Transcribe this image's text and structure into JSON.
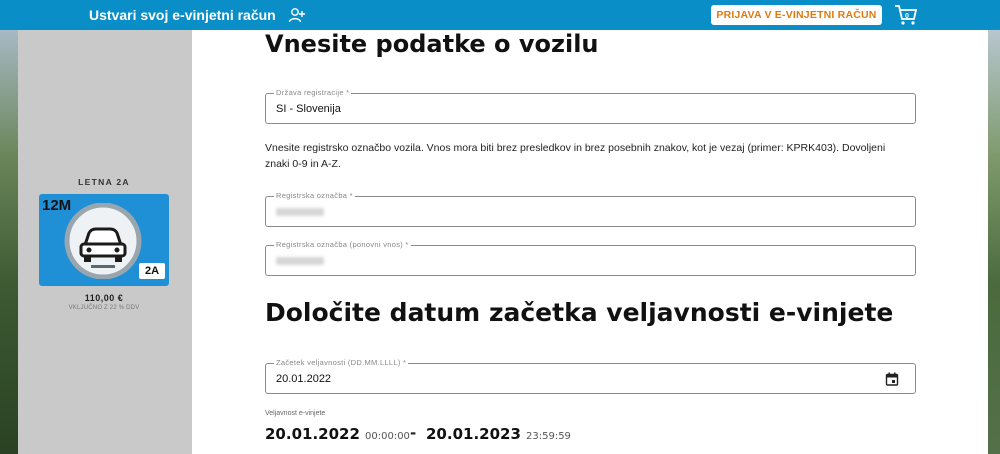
{
  "header": {
    "register_label": "Ustvari svoj e-vinjetni račun",
    "login_label": "PRIJAVA V E-VINJETNI RAČUN",
    "cart_count": "0",
    "brand_color": "#0a8ec8",
    "login_color": "#e07a10"
  },
  "vignette": {
    "title": "LETNA 2A",
    "duration_badge": "12M",
    "class_badge": "2A",
    "price": "110,00 €",
    "vat_note": "VKLJUČNO Z 22 % DDV",
    "card_color": "#1f8fd6"
  },
  "vehicle_section": {
    "heading": "Vnesite podatke o vozilu",
    "country_label": "Država registracije *",
    "country_value": "SI - Slovenija",
    "instructions": "Vnesite registrsko označbo vozila. Vnos mora biti brez presledkov in brez posebnih znakov, kot je vezaj (primer: KPRK403). Dovoljeni znaki 0-9 in A-Z.",
    "plate_label": "Registrska označba *",
    "plate_repeat_label": "Registrska označba (ponovni vnos) *"
  },
  "date_section": {
    "heading": "Določite datum začetka veljavnosti e-vinjete",
    "start_label": "Začetek veljavnosti (DD.MM.LLLL) *",
    "start_value": "20.01.2022",
    "validity_label": "Veljavnost e-vinjete",
    "valid_from_date": "20.01.2022",
    "valid_from_time": "00:00:00",
    "separator": "-",
    "valid_to_date": "20.01.2023",
    "valid_to_time": "23:59:59"
  }
}
